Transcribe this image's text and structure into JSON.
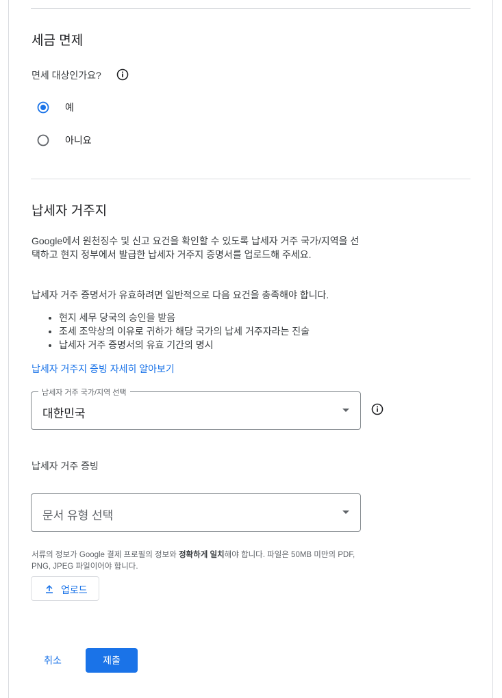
{
  "tax_exemption": {
    "title": "세금 면제",
    "question": "면세 대상인가요?",
    "options": [
      {
        "label": "예",
        "selected": true
      },
      {
        "label": "아니요",
        "selected": false
      }
    ]
  },
  "residency": {
    "title": "납세자 거주지",
    "description": "Google에서 원천징수 및 신고 요건을 확인할 수 있도록 납세자 거주 국가/지역을 선택하고 현지 정부에서 발급한 납세자 거주지 증명서를 업로드해 주세요.",
    "requirements_intro": "납세자 거주 증명서가 유효하려면 일반적으로 다음 요건을 충족해야 합니다.",
    "requirements": [
      "현지 세무 당국의 승인을 받음",
      "조세 조약상의 이유로 귀하가 해당 국가의 납세 거주자라는 진술",
      "납세자 거주 증명서의 유효 기간의 명시"
    ],
    "learn_more_link": "납세자 거주지 증빙 자세히 알아보기",
    "country_select": {
      "label": "납세자 거주 국가/지역 선택",
      "value": "대한민국"
    },
    "proof_label": "납세자 거주 증빙",
    "doc_type_select": {
      "placeholder": "문서 유형 선택"
    },
    "file_note_prefix": "서류의 정보가 Google 결제 프로필의 정보와 ",
    "file_note_bold": "정확하게 일치",
    "file_note_suffix": "해야 합니다. 파일은 50MB 미만의 PDF, PNG, JPEG 파일이어야 합니다.",
    "upload_label": "업로드"
  },
  "actions": {
    "cancel_label": "취소",
    "submit_label": "제출"
  },
  "colors": {
    "accent": "#1a73e8",
    "divider": "#dadce0",
    "text": "#202124"
  }
}
